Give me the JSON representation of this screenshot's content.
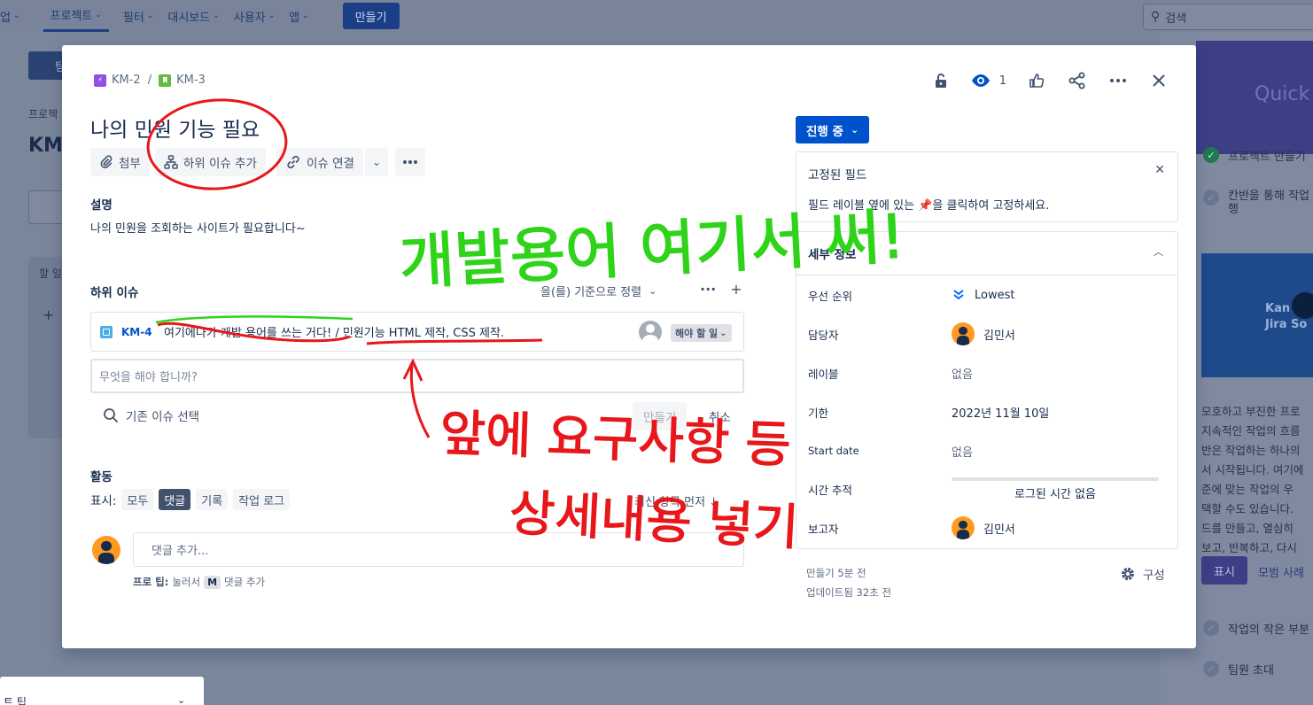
{
  "topnav": {
    "items": [
      {
        "label": "업",
        "chevron": true
      },
      {
        "label": "프로젝트",
        "chevron": true,
        "active": true
      },
      {
        "label": "필터",
        "chevron": true
      },
      {
        "label": "대시보드",
        "chevron": true
      },
      {
        "label": "사용자",
        "chevron": true
      },
      {
        "label": "앱",
        "chevron": true
      }
    ],
    "create_label": "만들기",
    "search_placeholder": "검색"
  },
  "background": {
    "button_fragment": "팀",
    "breadcrumb_fragment": "프로젝",
    "title_fragment": "KM",
    "column_label_fragment": "할 일",
    "bottom_panel_label": "트 팁",
    "quickstart": {
      "header": "Quick",
      "items": [
        {
          "label": "프로젝트 만들기",
          "done": true
        },
        {
          "label": "칸반을 통해 작업 행",
          "done": false
        }
      ],
      "video_title": "Kan Jira So",
      "paragraph": [
        "모호하고 부진한 프로",
        "지속적인 작업의 흐름",
        "반은 작업하는 하나의",
        "서 시작됩니다. 여기에",
        "준에 맞는 작업의 우",
        "택할 수도 있습니다.",
        "드를 만들고, 열심히",
        "보고, 반복하고, 다시"
      ],
      "show_label": "표시",
      "example_label": "모범 사례",
      "bottom_items": [
        {
          "label": "작업의 작은 부분"
        },
        {
          "label": "팀원 초대"
        }
      ]
    }
  },
  "issue": {
    "breadcrumbs": [
      {
        "key": "KM-2",
        "type": "epic"
      },
      {
        "key": "KM-3",
        "type": "story"
      }
    ],
    "watch_count": "1",
    "title": "나의 민원 기능 필요",
    "toolbar": {
      "attach": "첨부",
      "add_child": "하위 이슈 추가",
      "link_issue": "이슈 연결"
    },
    "description_label": "설명",
    "description": "나의 민원을 조회하는 사이트가 필요합니다~",
    "subtasks_label": "하위 이슈",
    "sort_label": "을(를) 기준으로 정렬",
    "subtask": {
      "key": "KM-4",
      "summary": "여기에다가 개발 용어를 쓰는 거다! / 민원기능 HTML 제작, CSS 제작.",
      "status": "해야 할 일"
    },
    "new_subtask_placeholder": "무엇을 해야 합니까?",
    "existing_issue": "기존 이슈 선택",
    "create_label": "만들기",
    "cancel_label": "취소",
    "activity_label": "활동",
    "show_label": "표시:",
    "activity_filters": [
      {
        "label": "모두",
        "selected": false
      },
      {
        "label": "댓글",
        "selected": true
      },
      {
        "label": "기록",
        "selected": false
      },
      {
        "label": "작업 로그",
        "selected": false
      }
    ],
    "sort_newest": "최신 항목 먼저",
    "comment_placeholder": "댓글 추가...",
    "pro_tip_prefix": "프로 팁:",
    "pro_tip_middle": "눌러서",
    "pro_tip_key": "M",
    "pro_tip_suffix": "댓글 추가"
  },
  "sidebar": {
    "status": "진행 중",
    "pinned_title": "고정된 필드",
    "pinned_text_before": "필드 레이블 옆에 있는",
    "pinned_text_after": "을 클릭하여 고정하세요.",
    "details_title": "세부 정보",
    "fields": [
      {
        "label": "우선 순위",
        "value": "Lowest",
        "kind": "priority"
      },
      {
        "label": "담당자",
        "value": "김민서",
        "kind": "user"
      },
      {
        "label": "레이블",
        "value": "없음",
        "kind": "muted"
      },
      {
        "label": "기한",
        "value": "2022년 11월 10일",
        "kind": "text"
      },
      {
        "label": "Start date",
        "value": "없음",
        "kind": "muted"
      },
      {
        "label": "시간 추적",
        "value": "로그된 시간 없음",
        "kind": "time"
      },
      {
        "label": "보고자",
        "value": "김민서",
        "kind": "user"
      }
    ],
    "created": "만들기 5분 전",
    "updated": "업데이트됨 32초 전",
    "configure": "구성"
  },
  "annotations": {
    "green_note": "개발용어 여기서 써!",
    "red_note_line1": "앞에 요구사항 등",
    "red_note_line2": "상세내용 넣기",
    "green_color": "#2fd41a",
    "red_color": "#e8171b"
  },
  "colors": {
    "primary": "#0052cc",
    "overlay": "#7a869a",
    "avatar": "#ff991f"
  }
}
